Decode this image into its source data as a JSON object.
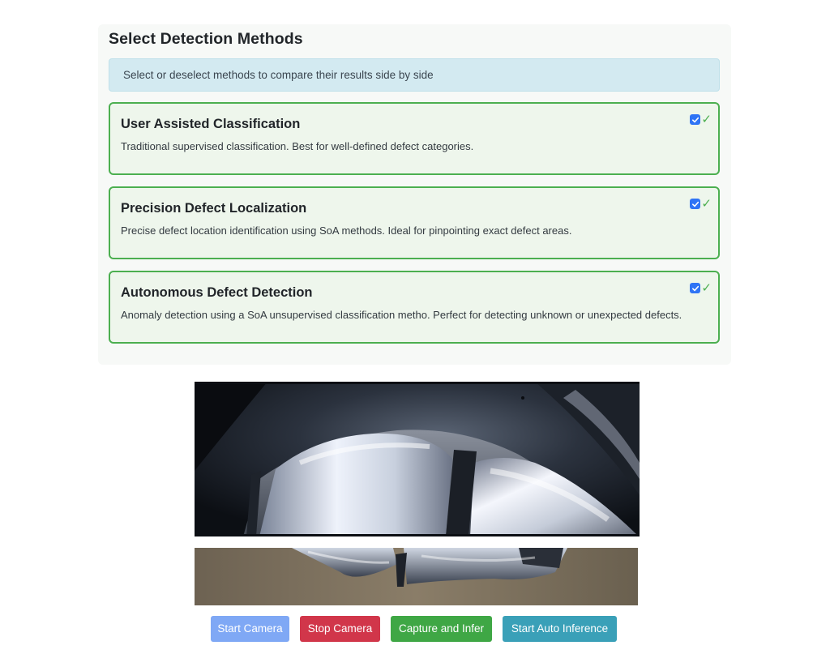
{
  "panel": {
    "title": "Select Detection Methods",
    "info": "Select or deselect methods to compare their results side by side"
  },
  "methods": [
    {
      "title": "User Assisted Classification",
      "description": "Traditional supervised classification. Best for well-defined defect categories.",
      "checked": true,
      "check_symbol": "✓"
    },
    {
      "title": "Precision Defect Localization",
      "description": "Precise defect location identification using SoA methods. Ideal for pinpointing exact defect areas.",
      "checked": true,
      "check_symbol": "✓"
    },
    {
      "title": "Autonomous Defect Detection",
      "description": "Anomaly detection using a SoA unsupervised classification metho. Perfect for detecting unknown or unexpected defects.",
      "checked": true,
      "check_symbol": "✓"
    }
  ],
  "controls": {
    "start_camera": "Start Camera",
    "stop_camera": "Stop Camera",
    "capture_infer": "Capture and Infer",
    "auto_inference": "Start Auto Inference"
  },
  "colors": {
    "selected_border": "#4caf50",
    "info_background": "#d3eaf1",
    "checkbox_blue": "#2f74f5",
    "start_button": "#7fa8f5",
    "stop_button": "#d1364a",
    "capture_button": "#3fa745",
    "auto_button": "#3aa0b8"
  }
}
